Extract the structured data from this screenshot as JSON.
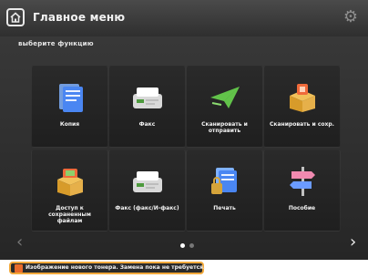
{
  "header": {
    "title": "Главное меню"
  },
  "subtitle": "выберите функцию",
  "tiles": [
    {
      "label": "Копия",
      "icon": "copy-icon"
    },
    {
      "label": "Факс",
      "icon": "fax-icon"
    },
    {
      "label": "Сканировать и отправить",
      "icon": "scan-send-icon"
    },
    {
      "label": "Сканировать и сохр.",
      "icon": "scan-save-icon"
    },
    {
      "label": "Доступ к сохраненным файлам",
      "icon": "stored-files-icon"
    },
    {
      "label": "Факс (факс/И-факс)",
      "icon": "fax-ifax-icon"
    },
    {
      "label": "Печать",
      "icon": "print-icon"
    },
    {
      "label": "Пособие",
      "icon": "guide-icon"
    }
  ],
  "pagination": {
    "current": 1,
    "total": 2
  },
  "status": {
    "text": "Изображение нового тонера. Замена пока не требуется."
  },
  "colors": {
    "panel_bg": "#2f2f2f",
    "status_border": "#f2a93b",
    "status_warning": "#e86b2b"
  }
}
